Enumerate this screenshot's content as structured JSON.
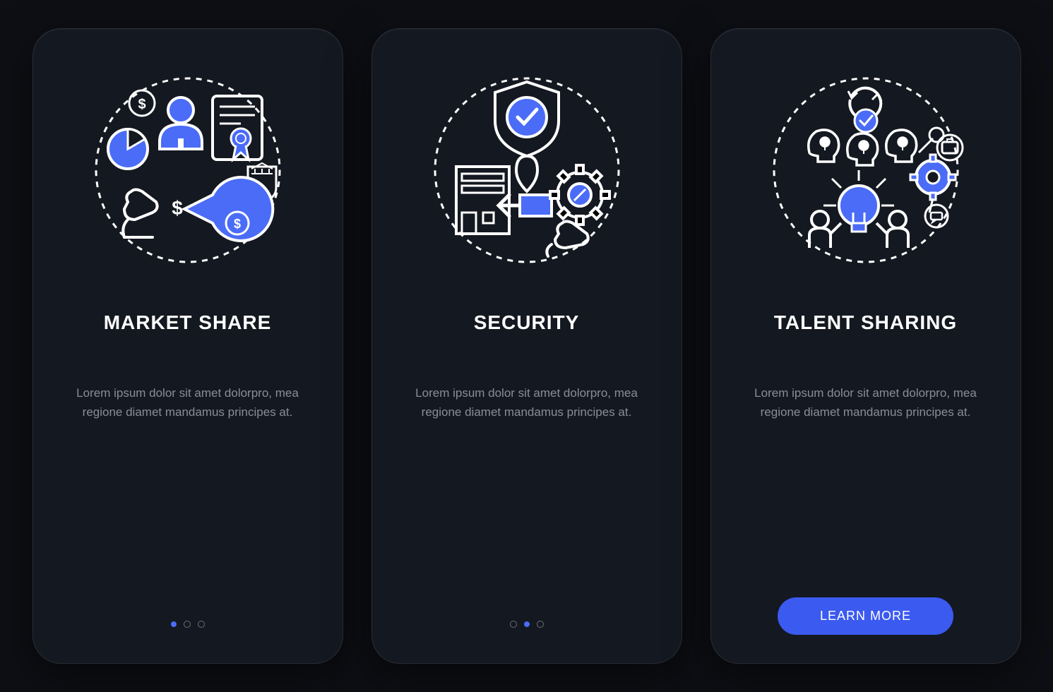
{
  "colors": {
    "accent": "#3b5af0",
    "background": "#0d0f14",
    "card": "#141820",
    "text_primary": "#ffffff",
    "text_secondary": "#8a8d95"
  },
  "cards": [
    {
      "title": "MARKET SHARE",
      "body": "Lorem ipsum dolor sit amet dolorpro, mea regione diamet mandamus principes at.",
      "icon": "market-share-icon",
      "pagination_active": 0,
      "has_cta": false
    },
    {
      "title": "SECURITY",
      "body": "Lorem ipsum dolor sit amet dolorpro, mea regione diamet mandamus principes at.",
      "icon": "security-icon",
      "pagination_active": 1,
      "has_cta": false
    },
    {
      "title": "TALENT SHARING",
      "body": "Lorem ipsum dolor sit amet dolorpro, mea regione diamet mandamus principes at.",
      "icon": "talent-sharing-icon",
      "pagination_active": 2,
      "has_cta": true
    }
  ],
  "cta_label": "LEARN MORE",
  "pagination_count": 3
}
